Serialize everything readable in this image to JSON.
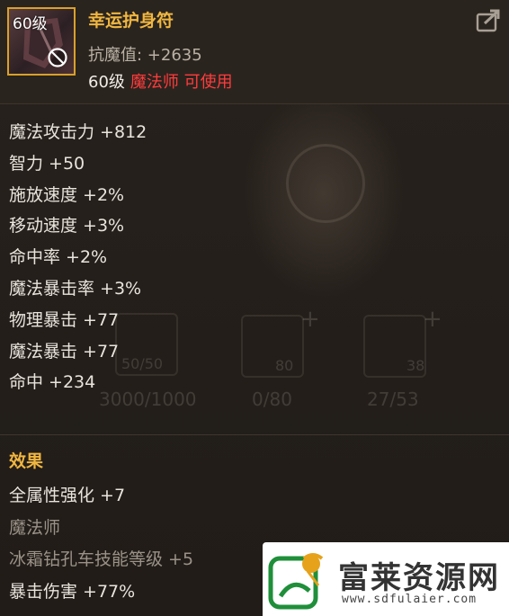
{
  "item": {
    "icon_level": "60级",
    "name": "幸运护身符",
    "magic_resist": "抗魔值: +2635",
    "requirement_level": "60级",
    "requirement_class": "魔法师 可使用"
  },
  "stats": [
    "魔法攻击力 +812",
    "智力 +50",
    "施放速度 +2%",
    "移动速度 +3%",
    "命中率 +2%",
    "魔法暴击率 +3%",
    "物理暴击 +77",
    "魔法暴击 +77",
    "命中 +234"
  ],
  "effects": {
    "title": "效果",
    "lines": [
      "全属性强化 +7",
      "魔法师",
      "冰霜钻孔车技能等级 +5",
      "暴击伤害 +77%"
    ]
  },
  "background_ghost": {
    "slot1_value": "50/50",
    "slot1_ratio": "3000/1000",
    "slot2_value": "80",
    "slot2_ratio": "0/80",
    "slot3_value": "38",
    "slot3_ratio": "27/53"
  },
  "watermark": {
    "name": "富莱资源网",
    "url": "www.sdfulaier.com"
  },
  "colors": {
    "item_name": "#f0b640",
    "class_restriction": "#ff3c3c",
    "icon_border": "#d8a12a"
  },
  "icons": {
    "share": "share-arrow-icon",
    "forbidden": "forbidden-icon"
  }
}
